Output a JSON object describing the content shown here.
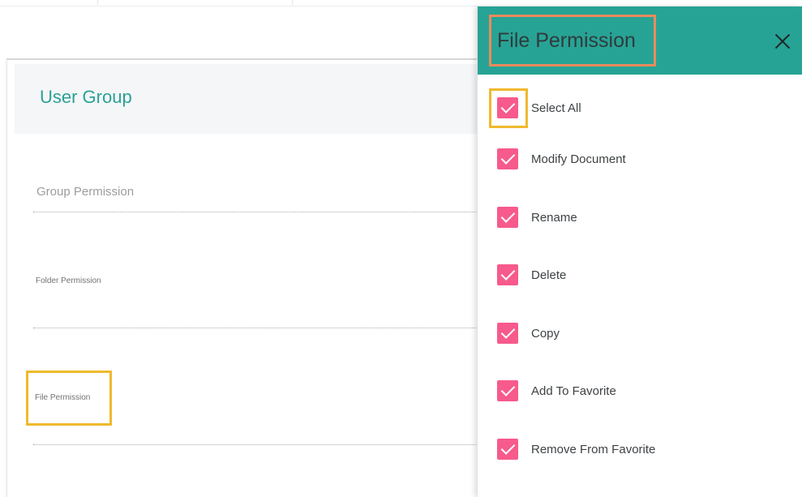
{
  "card": {
    "title": "User Group",
    "permissions": {
      "group": "Group Permission",
      "folder": "Folder Permission",
      "file": "File Permission"
    }
  },
  "drawer": {
    "title": "File Permission",
    "close_icon": "close-icon",
    "select_all": {
      "label": "Select All",
      "checked": true
    },
    "items": [
      {
        "label": "Modify Document",
        "checked": true
      },
      {
        "label": "Rename",
        "checked": true
      },
      {
        "label": "Delete",
        "checked": true
      },
      {
        "label": "Copy",
        "checked": true
      },
      {
        "label": "Add To Favorite",
        "checked": true
      },
      {
        "label": "Remove From Favorite",
        "checked": true
      }
    ]
  },
  "colors": {
    "accent_teal": "#27a395",
    "title_teal": "#2aa198",
    "checkbox_pink": "#f75a8c",
    "highlight_yellow": "#f0b92d",
    "highlight_orange": "#ef8a5c"
  }
}
